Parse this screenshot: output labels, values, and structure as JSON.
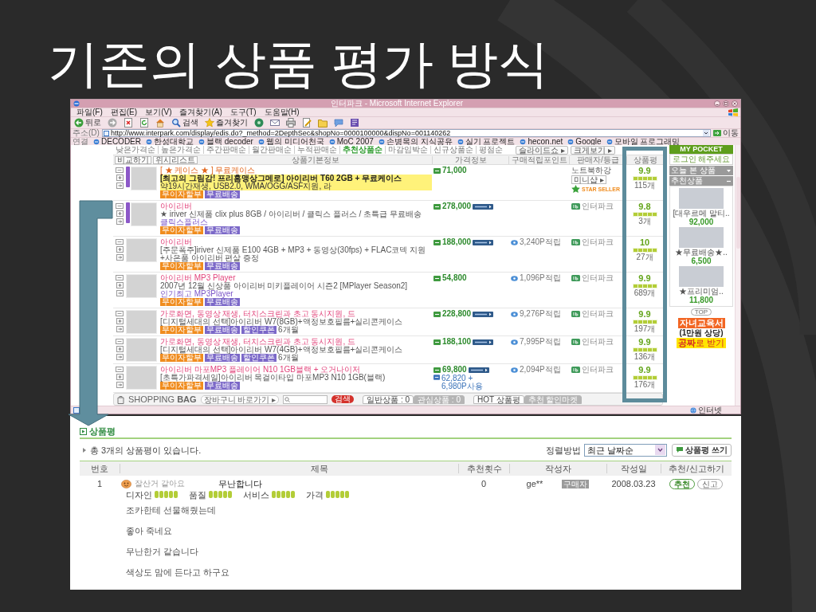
{
  "slide": {
    "title": "기존의 상품 평가 방식"
  },
  "browser": {
    "title": "인터파크 - Microsoft Internet Explorer",
    "menu": [
      "파일(F)",
      "편집(E)",
      "보기(V)",
      "즐겨찾기(A)",
      "도구(T)",
      "도움말(H)"
    ],
    "toolbar": [
      {
        "kind": "back",
        "label": "뒤로"
      },
      {
        "kind": "forward"
      },
      {
        "kind": "stop"
      },
      {
        "kind": "refresh"
      },
      {
        "kind": "home"
      },
      {
        "kind": "search",
        "label": "검색"
      },
      {
        "kind": "favorites",
        "label": "즐겨찾기"
      },
      {
        "kind": "media"
      },
      {
        "kind": "mail"
      },
      {
        "kind": "print"
      },
      {
        "kind": "edit"
      },
      {
        "kind": "folder"
      },
      {
        "kind": "messenger"
      },
      {
        "kind": "research"
      }
    ],
    "address": {
      "label": "주소(D)",
      "url": "http://www.interpark.com/display/edis.do?_method=2DepthSec&shopNo=0000100000&dispNo=001140262",
      "go": "이동"
    },
    "links": {
      "label": "연결",
      "items": [
        "DECODER",
        "한성대학교",
        "블랙 decoder",
        "웹의 미디어천국",
        "MoC 2007",
        "손병목의 지식공유",
        "실기 프로젝트",
        "hecon.net",
        "Google",
        "모바일 프로그래밍"
      ]
    },
    "sort_options": [
      {
        "label": "낮은가격순",
        "selected": false
      },
      {
        "label": "높은가격순",
        "selected": false
      },
      {
        "label": "주간판매순",
        "selected": false
      },
      {
        "label": "월간판매순",
        "selected": false
      },
      {
        "label": "누적판매순",
        "selected": false
      },
      {
        "label": "추천상품순",
        "selected": true
      },
      {
        "label": "마감임박순",
        "selected": false
      },
      {
        "label": "신규상품순",
        "selected": false
      },
      {
        "label": "평점순",
        "selected": false
      }
    ],
    "view_buttons": [
      "슬라이드쇼 ▸",
      "크게보기 ▸"
    ],
    "table": {
      "buttons": [
        "비교하기",
        "위시리스트"
      ],
      "columns": [
        "상품기본정보",
        "가격정보",
        "구매적립포인트",
        "판매자/등급",
        "상품평"
      ],
      "rows": [
        {
          "ribbon": true,
          "featured": true,
          "title": "[ ★ 케이스 ★ ] 무료케이스",
          "description": "[최고의 그림감! 프리홈맹상그메로] 아이리버 T60 2GB + 무료케이스",
          "detail": "약19시간재생, USB2.0, WMA/OGG/ASF지원, 라",
          "badges": [
            {
              "text": "무이자할부",
              "color": "#f08c1e"
            },
            {
              "text": "무료배송",
              "color": "#7b68c8"
            }
          ],
          "price": "71,000",
          "coupon": false,
          "seller": {
            "kind": "shop",
            "name": "노트북하강",
            "shop": "미니샵 ▸",
            "grade": "STAR SELLER"
          },
          "score": "9.9",
          "stars": 5,
          "count": "115개"
        },
        {
          "ribbon": true,
          "featured": false,
          "title": "아이리버",
          "description": "★ iriver 신제품 clix plus 8GB / 아이리버 / 클릭스 플러스 / 초특급 무료배송",
          "link": "클릭스플러스",
          "badges": [
            {
              "text": "무이자할부",
              "color": "#f08c1e"
            },
            {
              "text": "무료배송",
              "color": "#7b68c8"
            }
          ],
          "price": "278,000",
          "coupon": true,
          "seller": {
            "kind": "interpark",
            "name": "인터파크"
          },
          "score": "9.8",
          "stars": 5,
          "count": "3개"
        },
        {
          "ribbon": false,
          "featured": false,
          "title": "아이리버",
          "description": "[주문폭주]iriver 신제품 E100 4GB + MP3 + 동영상(30fps) + FLAC코덱 지원+사은품 아이리버 편살 증정",
          "badges": [
            {
              "text": "무이자할부",
              "color": "#f08c1e"
            },
            {
              "text": "무료배송",
              "color": "#7b68c8"
            }
          ],
          "price": "188,000",
          "coupon": true,
          "points": "3,240P적립",
          "seller": {
            "kind": "interpark",
            "name": "인터파크"
          },
          "score": "10",
          "stars": 5,
          "count": "27개"
        },
        {
          "ribbon": false,
          "featured": false,
          "title": "아이리버 MP3 Player",
          "description": "2007년 12월 신상품 아이리버 미키플레이어 시즌2 [MPlayer Season2]",
          "link": "인기최고 MP3Player",
          "badges": [
            {
              "text": "무이자할부",
              "color": "#f08c1e"
            },
            {
              "text": "무료배송",
              "color": "#7b68c8"
            }
          ],
          "price": "54,800",
          "coupon": false,
          "points": "1,096P적립",
          "seller": {
            "kind": "interpark",
            "name": "인터파크"
          },
          "score": "9.9",
          "stars": 5,
          "count": "689개"
        },
        {
          "ribbon": false,
          "featured": false,
          "title": "가로화면, 동영상 재생, 터치스크린과 초고 동시지원, 드",
          "description": "[디지털세대의 선택]아이리버 W7(8GB)+액정보호필름+실리콘케이스",
          "badges": [
            {
              "text": "무이자할부",
              "color": "#f08c1e"
            },
            {
              "text": "무료배송",
              "color": "#7b68c8"
            },
            {
              "text": "할인쿠폰",
              "color": "#7b68c8"
            }
          ],
          "badge_note": "6개월",
          "price": "228,800",
          "coupon": true,
          "points": "9,276P적립",
          "seller": {
            "kind": "interpark",
            "name": "인터파크"
          },
          "score": "9.9",
          "stars": 5,
          "count": "197개"
        },
        {
          "ribbon": false,
          "featured": false,
          "title": "가로화면, 동영상 재생, 터치스크린과 초고 동시지원, 드",
          "description": "[디지털세대의 선택]아이리버 W7(4GB)+액정보호필름+실리콘케이스",
          "badges": [
            {
              "text": "무이자할부",
              "color": "#f08c1e"
            },
            {
              "text": "무료배송",
              "color": "#7b68c8"
            },
            {
              "text": "할인쿠폰",
              "color": "#7b68c8"
            }
          ],
          "badge_note": "6개월",
          "price": "188,100",
          "coupon": true,
          "points": "7,995P적립",
          "seller": {
            "kind": "interpark",
            "name": "인터파크"
          },
          "score": "9.9",
          "stars": 5,
          "count": "136개"
        },
        {
          "ribbon": false,
          "featured": false,
          "title": "아이리버 마포MP3 플레이어 N10 1GB블랙 + 오거나이저",
          "description": "[초특가파격세일]아이리버 목걸이타입 마포MP3 N10 1GB(블랙)",
          "badges": [
            {
              "text": "무이자할부",
              "color": "#f08c1e"
            },
            {
              "text": "무료배송",
              "color": "#7b68c8"
            }
          ],
          "price": "69,800",
          "coupon": true,
          "price_note": "62,820 + 6,980P사용",
          "points": "2,094P적립",
          "seller": {
            "kind": "interpark",
            "name": "인터파크"
          },
          "score": "9.9",
          "stars": 5,
          "count": "176개"
        }
      ]
    },
    "sidebar": {
      "title": "MY POCKET",
      "login": "로그인 해주세요",
      "tabs": [
        {
          "label": "오늘 본 상품",
          "expanded": false
        },
        {
          "label": "추천상품",
          "expanded": true
        }
      ],
      "products": [
        {
          "name": "[대우르메 말티..",
          "price": "92,000"
        },
        {
          "name": "★무료배송★..",
          "price": "6,500"
        },
        {
          "name": "★프리미엄..",
          "price": "11,800"
        }
      ],
      "top": "TOP",
      "ad": {
        "headline": "자녀교육서",
        "value": "(1만원 상당)",
        "offer": "**공짜**로 받기"
      }
    },
    "shopping_bag": {
      "title": "SHOPPING **BAG**",
      "cart_link": "장바구니 바로가기 ▸",
      "search_button": "검색",
      "cart_tabs": [
        {
          "label": "일반상품 : 0",
          "selected": true
        },
        {
          "label": "관심상품 : 0",
          "selected": false
        }
      ],
      "hot_tabs": [
        {
          "label": "HOT 상품평",
          "selected": true
        },
        {
          "label": "추천 할인마켓",
          "selected": false
        }
      ]
    },
    "status_bar": {
      "zone": "인터넷"
    }
  },
  "reviews": {
    "heading": "상품평",
    "summary": "총 3개의 상품평이 있습니다.",
    "sort": {
      "label": "정렬방법",
      "value": "최근 날짜순"
    },
    "write_button": "상품평 쓰기",
    "columns": [
      "번호",
      "제목",
      "추천횟수",
      "작성자",
      "작성일",
      "추천/신고하기"
    ],
    "rows": [
      {
        "number": "1",
        "mood": "잘산거 같아요",
        "title": "무난합니다",
        "recommend_count": "0",
        "author": "ge**",
        "author_badge": "구매자",
        "date": "2008.03.23",
        "actions": [
          "추천",
          "신고"
        ],
        "ratings": [
          {
            "label": "디자인",
            "stars": 5
          },
          {
            "label": "품질",
            "stars": 5
          },
          {
            "label": "서비스",
            "stars": 5
          },
          {
            "label": "가격",
            "stars": 5
          }
        ],
        "body": [
          "조카한테 선물해줬는데",
          "좋아 죽네요",
          "무난한거 같습니다",
          "색상도 맘에 든다고 하구요"
        ]
      }
    ]
  }
}
